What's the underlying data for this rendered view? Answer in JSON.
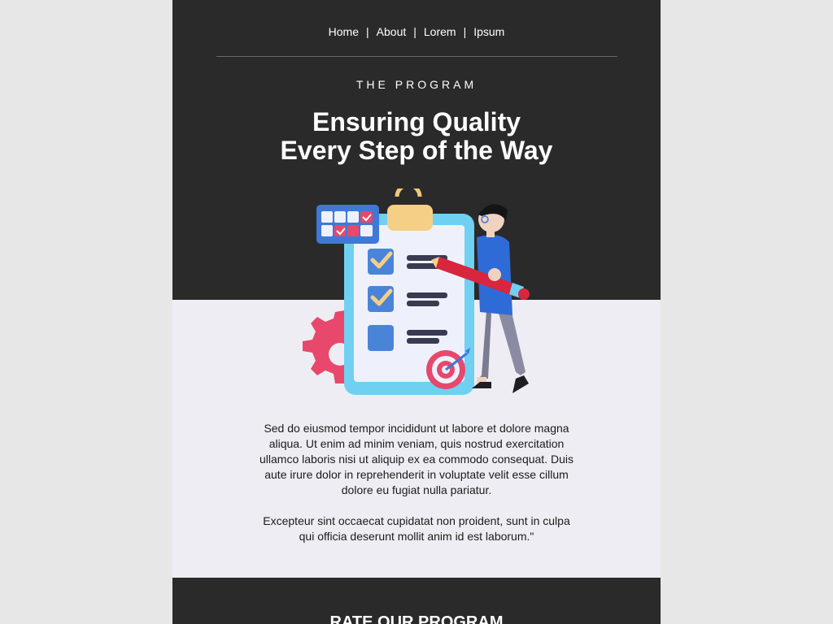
{
  "nav": {
    "items": [
      {
        "label": "Home"
      },
      {
        "label": "About"
      },
      {
        "label": "Lorem"
      },
      {
        "label": "Ipsum"
      }
    ],
    "separator": "|"
  },
  "hero": {
    "eyebrow": "THE PROGRAM",
    "headline_line1": "Ensuring Quality",
    "headline_line2": "Every Step of the Way",
    "illustration": "checklist-clipboard-with-person-holding-pencil"
  },
  "body": {
    "paragraph1": "Sed do eiusmod tempor incididunt ut labore et dolore magna aliqua. Ut enim ad minim veniam, quis nostrud exercitation ullamco laboris nisi ut aliquip ex ea commodo consequat. Duis aute irure dolor in reprehenderit in voluptate velit esse cillum dolore eu fugiat nulla pariatur.",
    "paragraph2": "Excepteur sint occaecat cupidatat non proident, sunt in culpa qui officia deserunt mollit anim id est laborum.\""
  },
  "footer": {
    "rate_title": "RATE OUR PROGRAM"
  },
  "colors": {
    "dark_background": "#2a2a2a",
    "light_background": "#eeedf3",
    "outer_background": "#e7e7e7",
    "text_light": "#ffffff",
    "text_dark": "#1b1b1b"
  }
}
